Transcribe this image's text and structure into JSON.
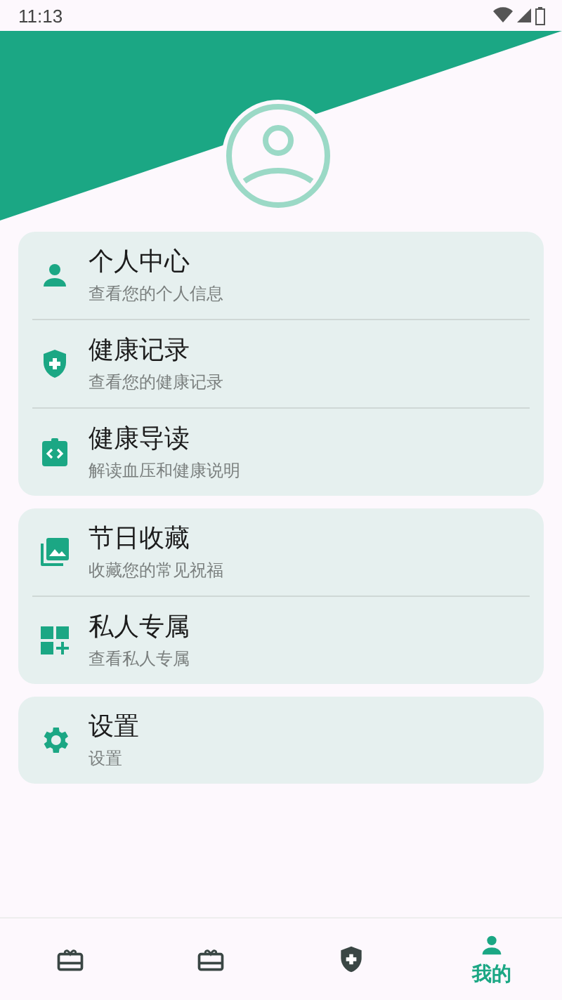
{
  "status_bar": {
    "time": "11:13"
  },
  "menu_groups": [
    {
      "items": [
        {
          "kind": "person",
          "title": "个人中心",
          "subtitle": "查看您的个人信息"
        },
        {
          "kind": "shield",
          "title": "健康记录",
          "subtitle": "查看您的健康记录"
        },
        {
          "kind": "code",
          "title": "健康导读",
          "subtitle": "解读血压和健康说明"
        }
      ]
    },
    {
      "items": [
        {
          "kind": "photos",
          "title": "节日收藏",
          "subtitle": "收藏您的常见祝福"
        },
        {
          "kind": "widgets",
          "title": "私人专属",
          "subtitle": "查看私人专属"
        }
      ]
    },
    {
      "items": [
        {
          "kind": "gear",
          "title": "设置",
          "subtitle": "设置"
        }
      ]
    }
  ],
  "bottom_nav": [
    {
      "kind": "gift",
      "selected": false
    },
    {
      "kind": "gift",
      "selected": false
    },
    {
      "kind": "shield",
      "selected": false
    },
    {
      "kind": "person",
      "label": "我的",
      "selected": true
    }
  ]
}
